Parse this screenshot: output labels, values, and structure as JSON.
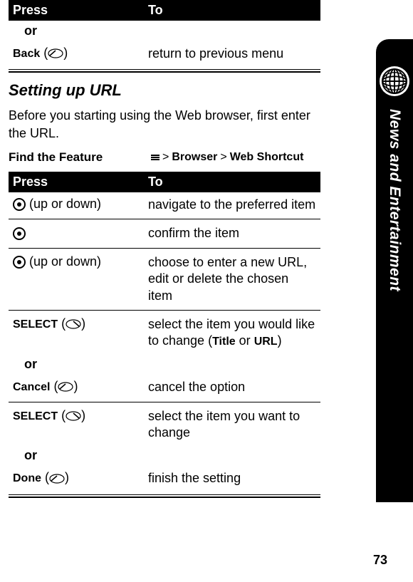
{
  "top_table": {
    "header": {
      "press": "Press",
      "to": "To"
    },
    "or": "or",
    "back_label": "Back",
    "back_to": "return to previous menu"
  },
  "section": {
    "heading": "Setting up URL",
    "body": "Before you starting using the Web browser, first enter the URL."
  },
  "feature": {
    "label": "Find the Feature",
    "sep": ">",
    "browser": "Browser",
    "web_shortcut": "Web Shortcut"
  },
  "table2": {
    "header": {
      "press": "Press",
      "to": "To"
    },
    "row1": {
      "press_suffix": " (up or down)",
      "to": "navigate to the preferred item"
    },
    "row2": {
      "to": "confirm the item"
    },
    "row3": {
      "press_suffix": " (up or down)",
      "to": "choose to enter a new URL, edit or delete the chosen item"
    },
    "row4": {
      "select": "SELECT",
      "to_prefix": "select the item you would like to change (",
      "title": "Title",
      "or_word": " or ",
      "url": "URL",
      "to_suffix": ")"
    },
    "or": "or",
    "row5": {
      "cancel": "Cancel",
      "to": "cancel the option"
    },
    "row6": {
      "select": "SELECT",
      "to": "select the item you want to change"
    },
    "row7": {
      "done": "Done",
      "to": "finish the setting"
    }
  },
  "side_label": "News and Entertainment",
  "page_number": "73"
}
